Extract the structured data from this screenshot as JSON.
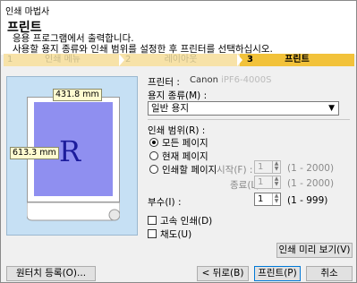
{
  "window": {
    "title": "인쇄 마법사"
  },
  "header": {
    "title": "프린트",
    "desc_line1": "응용 프로그램에서 출력합니다.",
    "desc_line2": "사용할 용지 종류와 인쇄 범위를 설정한 후 프린터를 선택하십시오."
  },
  "steps": [
    {
      "num": "1",
      "label": "인쇄 메뉴"
    },
    {
      "num": "2",
      "label": "레이아웃"
    },
    {
      "num": "3",
      "label": "프린트"
    }
  ],
  "preview": {
    "width_label": "431.8 mm",
    "height_label": "613.3 mm",
    "letter": "R"
  },
  "printer": {
    "label": "프린터 :",
    "value": "Canon",
    "value_model": "iPF6-4000S"
  },
  "paper": {
    "label": "용지 종류(M) :",
    "selected": "일반 용지"
  },
  "range": {
    "label": "인쇄 범위(R) :",
    "all": "모든 페이지",
    "current": "현재 페이지",
    "pages": "인쇄할 페이지",
    "start_label": "시작(F) :",
    "start_value": "1",
    "start_range": "(1 - 2000)",
    "end_label": "종료(L) :",
    "end_value": "1",
    "end_range": "(1 - 2000)"
  },
  "copies": {
    "label": "부수(I) :",
    "value": "1",
    "range": "(1 - 999)"
  },
  "options": {
    "fast": "고속 인쇄(D)",
    "color": "채도(U)"
  },
  "buttons": {
    "preview": "인쇄 미리 보기(V)",
    "register": "원터치 등록(O)...",
    "back": "< 뒤로(B)",
    "print": "프린트(P)",
    "cancel": "취소"
  }
}
